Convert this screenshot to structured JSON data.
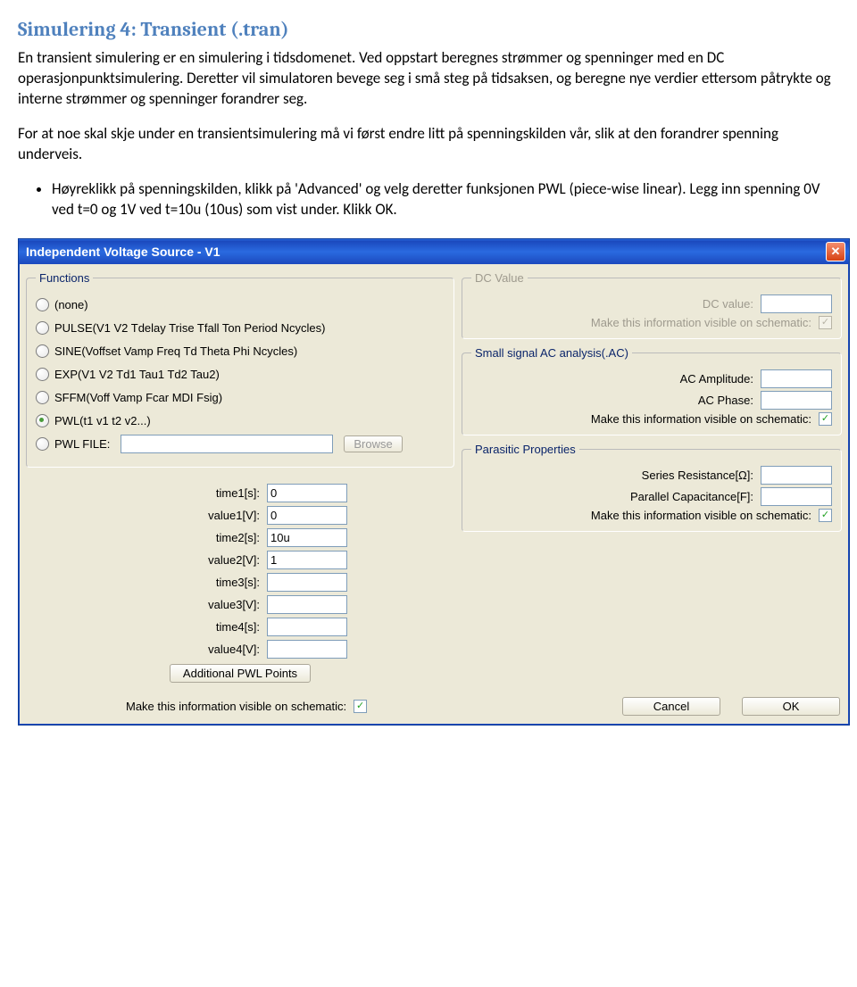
{
  "doc": {
    "heading": "Simulering 4: Transient  (.tran)",
    "para1": "En transient simulering er en simulering i tidsdomenet. Ved oppstart beregnes strømmer og spenninger med en DC operasjonpunktsimulering. Deretter vil simulatoren bevege seg i små steg på tidsaksen, og beregne nye verdier ettersom påtrykte og interne strømmer og spenninger forandrer seg.",
    "para2": "For at noe skal skje under en transientsimulering må vi først endre litt på spenningskilden vår, slik at den forandrer spenning underveis.",
    "bullet1": "Høyreklikk på spenningskilden, klikk på 'Advanced' og velg deretter funksjonen PWL (piece-wise linear). Legg inn spenning 0V ved t=0 og 1V ved t=10u  (10us) som vist under. Klikk OK."
  },
  "dialog": {
    "title": "Independent Voltage Source - V1",
    "close_glyph": "✕",
    "functions": {
      "legend": "Functions",
      "options": [
        {
          "label": "(none)",
          "selected": false
        },
        {
          "label": "PULSE(V1 V2 Tdelay Trise Tfall Ton Period Ncycles)",
          "selected": false
        },
        {
          "label": "SINE(Voffset Vamp Freq Td Theta Phi Ncycles)",
          "selected": false
        },
        {
          "label": "EXP(V1 V2 Td1 Tau1 Td2 Tau2)",
          "selected": false
        },
        {
          "label": "SFFM(Voff Vamp Fcar MDI Fsig)",
          "selected": false
        },
        {
          "label": "PWL(t1 v1 t2 v2...)",
          "selected": true
        },
        {
          "label": "PWL FILE:",
          "selected": false,
          "hasFile": true
        }
      ],
      "browse": "Browse"
    },
    "dc": {
      "legend": "DC Value",
      "value_label": "DC value:",
      "visible_label": "Make this information visible on schematic:"
    },
    "ac": {
      "legend": "Small signal AC analysis(.AC)",
      "amp_label": "AC Amplitude:",
      "phase_label": "AC Phase:",
      "visible_label": "Make this information visible on schematic:"
    },
    "parasitic": {
      "legend": "Parasitic Properties",
      "res_label": "Series Resistance[Ω]:",
      "cap_label": "Parallel Capacitance[F]:",
      "visible_label": "Make this information visible on schematic:"
    },
    "pwl": {
      "rows": [
        {
          "label": "time1[s]:",
          "value": "0"
        },
        {
          "label": "value1[V]:",
          "value": "0"
        },
        {
          "label": "time2[s]:",
          "value": "10u"
        },
        {
          "label": "value2[V]:",
          "value": "1"
        },
        {
          "label": "time3[s]:",
          "value": ""
        },
        {
          "label": "value3[V]:",
          "value": ""
        },
        {
          "label": "time4[s]:",
          "value": ""
        },
        {
          "label": "value4[V]:",
          "value": ""
        }
      ],
      "additional": "Additional PWL Points"
    },
    "footer": {
      "visible_label": "Make this information visible on schematic:",
      "cancel": "Cancel",
      "ok": "OK"
    }
  }
}
